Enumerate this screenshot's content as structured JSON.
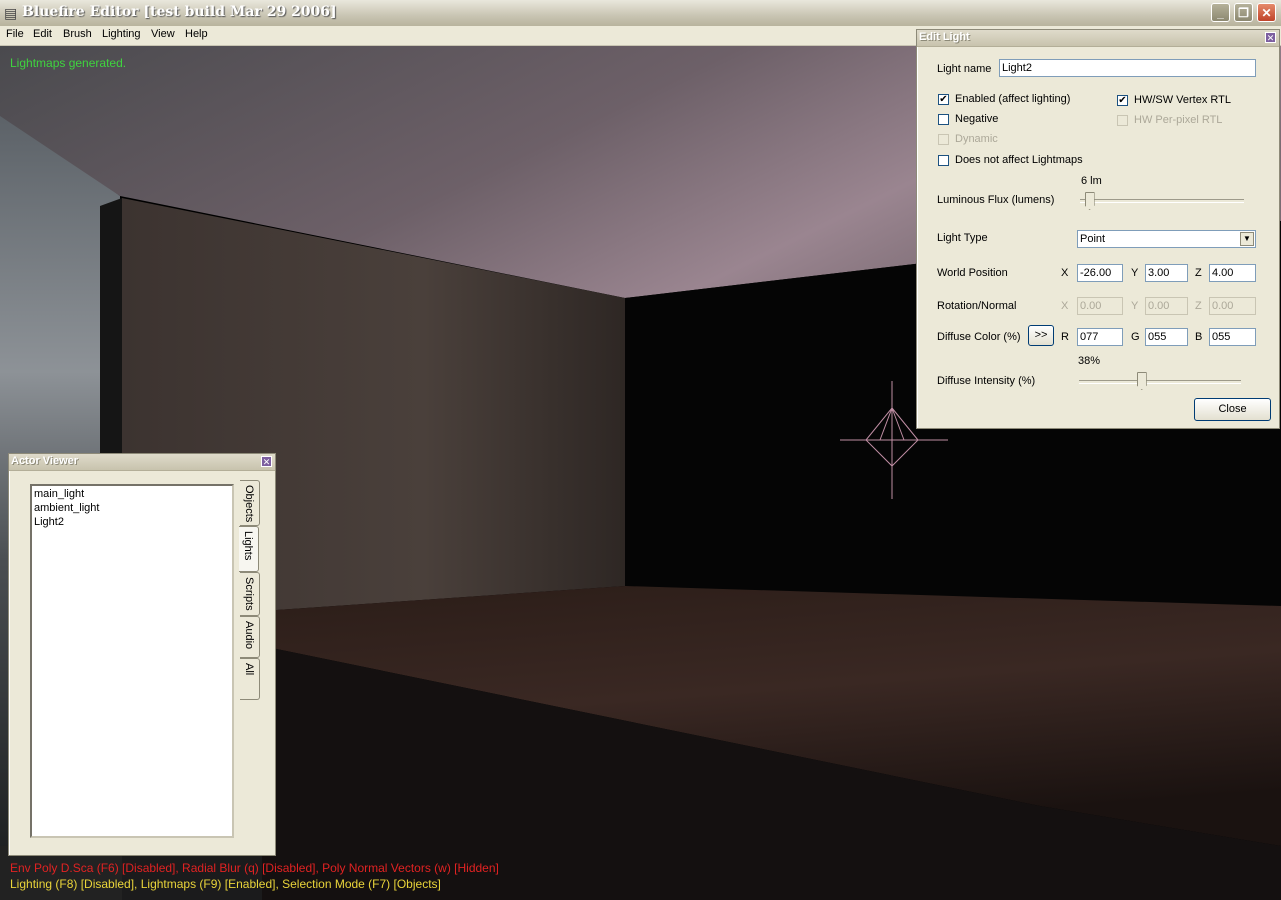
{
  "window": {
    "title": "Bluefire Editor [test build Mar 29 2006]",
    "min_glyph": "_",
    "max_glyph": "❐",
    "close_glyph": "✕"
  },
  "menu": [
    "File",
    "Edit",
    "Brush",
    "Lighting",
    "View",
    "Help"
  ],
  "viewport": {
    "message": "Lightmaps generated.",
    "status_line_1": "Env Poly D.Sca (F6) [Disabled], Radial Blur (q) [Disabled], Poly Normal Vectors (w) [Hidden]",
    "status_line_2": "Lighting (F8) [Disabled], Lightmaps (F9) [Enabled], Selection Mode (F7) [Objects]"
  },
  "edit_light": {
    "title": "Edit Light",
    "close_glyph": "✕",
    "light_name_label": "Light name",
    "light_name_value": "Light2",
    "enabled_label": "Enabled (affect lighting)",
    "enabled_checked": "✔",
    "hw_sw_label": "HW/SW Vertex RTL",
    "hw_sw_checked": "✔",
    "negative_label": "Negative",
    "hw_perpixel_label": "HW Per-pixel RTL",
    "dynamic_label": "Dynamic",
    "no_lightmaps_label": "Does not affect Lightmaps",
    "flux_label": "Luminous Flux (lumens)",
    "flux_value": "6 lm",
    "flux_level": 0.03,
    "light_type_label": "Light Type",
    "light_type_value": "Point",
    "light_type_arrow": "▼",
    "world_position_label": "World Position",
    "world_x": "-26.00",
    "world_y": "3.00",
    "world_z": "4.00",
    "rotation_label": "Rotation/Normal",
    "rot_x": "0.00",
    "rot_y": "0.00",
    "rot_z": "0.00",
    "x_label": "X",
    "y_label": "Y",
    "z_label": "Z",
    "diffuse_color_label": "Diffuse Color (%)",
    "color_button": ">>",
    "r_label": "R",
    "g_label": "G",
    "b_label": "B",
    "r_value": "077",
    "g_value": "055",
    "b_value": "055",
    "intensity_value": "38%",
    "intensity_level": 0.38,
    "intensity_label": "Diffuse Intensity (%)",
    "close_button": "Close"
  },
  "actor_viewer": {
    "title": "Actor Viewer",
    "close_glyph": "✕",
    "items": [
      "main_light",
      "ambient_light",
      "Light2"
    ],
    "tabs": [
      "Objects",
      "Lights",
      "Scripts",
      "Audio",
      "All"
    ],
    "active_tab": "Lights"
  },
  "colors": {
    "message_green": "#3fd43f",
    "status_red": "#e12222",
    "status_yellow": "#e9d43a",
    "panel_bg": "#ece9d8"
  }
}
